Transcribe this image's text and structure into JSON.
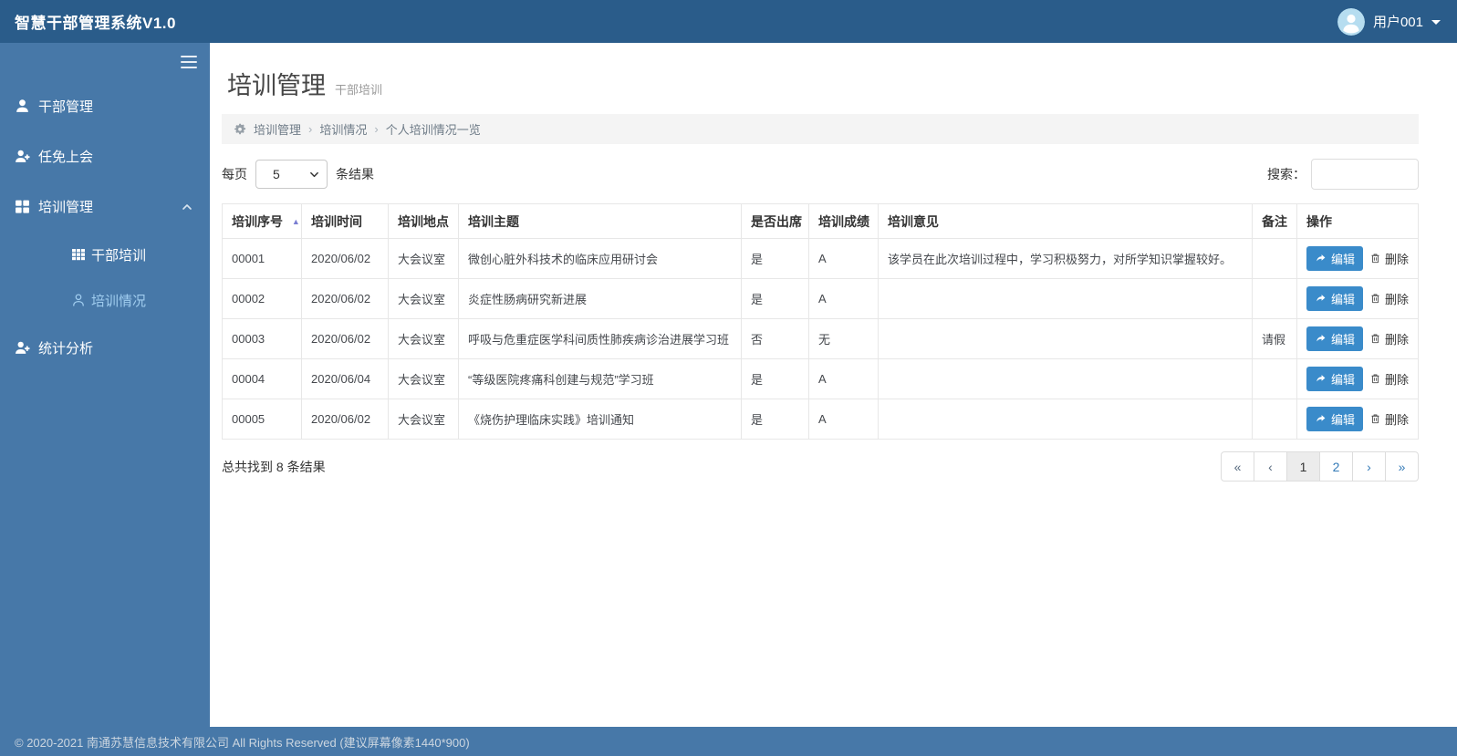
{
  "topbar": {
    "title": "智慧干部管理系统V1.0",
    "user_name": "用户001"
  },
  "sidebar": {
    "items": [
      {
        "label": "干部管理",
        "icon": "user-icon"
      },
      {
        "label": "任免上会",
        "icon": "user-plus-icon"
      },
      {
        "label": "培训管理",
        "icon": "grid-icon",
        "expanded": true,
        "children": [
          {
            "label": "干部培训",
            "icon": "table-grid-icon"
          },
          {
            "label": "培训情况",
            "icon": "user-outline-icon",
            "active": true
          }
        ]
      },
      {
        "label": "统计分析",
        "icon": "user-plus-icon"
      }
    ]
  },
  "page": {
    "title": "培训管理",
    "subtitle": "干部培训",
    "breadcrumb": {
      "items": [
        "培训管理",
        "培训情况",
        "个人培训情况一览"
      ],
      "separator": "›"
    }
  },
  "controls": {
    "per_page_prefix": "每页",
    "per_page_value": "5",
    "per_page_suffix": "条结果",
    "search_label": "搜索："
  },
  "table": {
    "columns": [
      "培训序号",
      "培训时间",
      "培训地点",
      "培训主题",
      "是否出席",
      "培训成绩",
      "培训意见",
      "备注",
      "操作"
    ],
    "sort_icon": "▲",
    "edit_label": "编辑",
    "delete_label": "删除",
    "rows": [
      {
        "seq": "00001",
        "time": "2020/06/02",
        "place": "大会议室",
        "topic": "微创心脏外科技术的临床应用研讨会",
        "attended": "是",
        "score": "A",
        "opinion": "该学员在此次培训过程中，学习积极努力，对所学知识掌握较好。",
        "note": ""
      },
      {
        "seq": "00002",
        "time": "2020/06/02",
        "place": "大会议室",
        "topic": "炎症性肠病研究新进展",
        "attended": "是",
        "score": "A",
        "opinion": "",
        "note": ""
      },
      {
        "seq": "00003",
        "time": "2020/06/02",
        "place": "大会议室",
        "topic": "呼吸与危重症医学科间质性肺疾病诊治进展学习班",
        "attended": "否",
        "score": "无",
        "opinion": "",
        "note": "请假"
      },
      {
        "seq": "00004",
        "time": "2020/06/04",
        "place": "大会议室",
        "topic": "“等级医院疼痛科创建与规范”学习班",
        "attended": "是",
        "score": "A",
        "opinion": "",
        "note": ""
      },
      {
        "seq": "00005",
        "time": "2020/06/02",
        "place": "大会议室",
        "topic": "《烧伤护理临床实践》培训通知",
        "attended": "是",
        "score": "A",
        "opinion": "",
        "note": ""
      }
    ]
  },
  "summary_text": "总共找到 8 条结果",
  "pagination": {
    "first": "«",
    "prev": "‹",
    "pages": [
      "1",
      "2"
    ],
    "active_page": "1",
    "next": "›",
    "last": "»"
  },
  "footer_text": "© 2020-2021 南通苏慧信息技术有限公司 All Rights Reserved (建议屏幕像素1440*900)",
  "colors": {
    "topbar_bg": "#2a5c8a",
    "sidebar_bg": "#4778a8",
    "footer_bg": "#4778a8",
    "edit_button_bg": "#3a8bca",
    "pagination_link": "#337ab7",
    "active_menu_text": "#a0cdef",
    "sort_icon": "#7a7ed2"
  }
}
